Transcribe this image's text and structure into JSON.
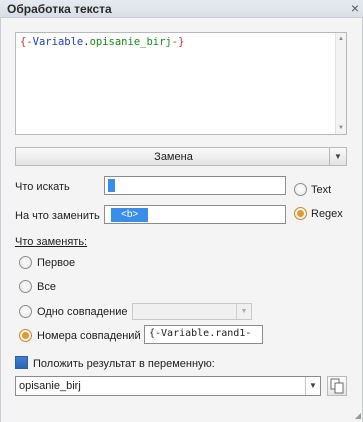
{
  "window": {
    "title": "Обработка текста",
    "close_glyph": "×"
  },
  "editor": {
    "brace_open": "{-",
    "namespace": "Variable",
    "dot": ".",
    "variable": "opisanie_birj",
    "brace_close": "-}"
  },
  "mode": {
    "selected": "Замена",
    "arrow": "▼"
  },
  "find": {
    "label": "Что искать",
    "value": ""
  },
  "replace": {
    "label": "На что заменить",
    "value": "<b>"
  },
  "match_type": {
    "options": [
      {
        "label": "Text",
        "checked": false
      },
      {
        "label": "Regex",
        "checked": true
      }
    ]
  },
  "what_to_replace": {
    "heading": "Что заменять:",
    "options": [
      {
        "label": "Первое",
        "checked": false
      },
      {
        "label": "Все",
        "checked": false
      },
      {
        "label": "Одно совпадение",
        "checked": false
      },
      {
        "label": "Номера совпадений",
        "checked": true
      }
    ],
    "one_match_value": "",
    "match_numbers_value": "{-Variable.rand1-"
  },
  "output": {
    "checkbox_label": "Положить результат в переменную:",
    "checked": true,
    "variable": "opisanie_birj",
    "arrow": "▼"
  },
  "icons": {
    "close": "close-icon",
    "dropdown": "chevron-down-icon",
    "copy": "copy-icon",
    "grip": "resize-grip-icon"
  },
  "colors": {
    "accent": "#3b8ee8",
    "radio_checked": "#e39a2a",
    "code_brace": "#c0392b",
    "code_namespace": "#1f3fbf",
    "code_variable": "#1a8a1a"
  }
}
